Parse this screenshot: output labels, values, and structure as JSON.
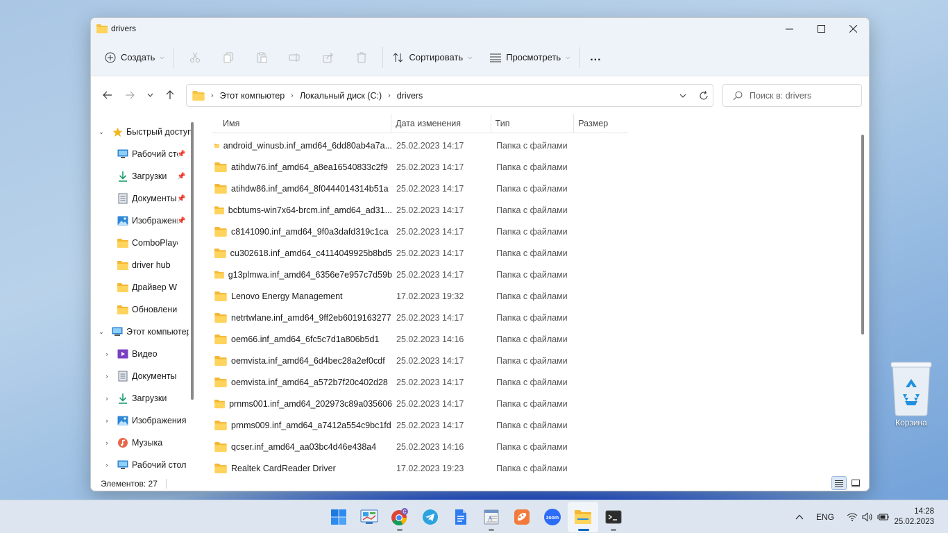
{
  "window": {
    "title": "drivers"
  },
  "toolbar": {
    "create_label": "Создать",
    "sort_label": "Сортировать",
    "view_label": "Просмотреть",
    "more_label": "..."
  },
  "address": {
    "crumbs": [
      "Этот компьютер",
      "Локальный диск (C:)",
      "drivers"
    ],
    "search_placeholder": "Поиск в: drivers"
  },
  "sidebar": {
    "quick_access": "Быстрый доступ",
    "quick_items": [
      {
        "label": "Рабочий стол",
        "icon": "desktop-icon",
        "pinned": true
      },
      {
        "label": "Загрузки",
        "icon": "download-icon",
        "pinned": true
      },
      {
        "label": "Документы",
        "icon": "documents-icon",
        "pinned": true
      },
      {
        "label": "Изображения",
        "icon": "pictures-icon",
        "pinned": true
      },
      {
        "label": "ComboPlayer",
        "icon": "folder-icon",
        "pinned": false
      },
      {
        "label": "driver hub",
        "icon": "folder-icon",
        "pinned": false
      },
      {
        "label": "Драйвер WIA",
        "icon": "folder-icon",
        "pinned": false
      },
      {
        "label": "Обновление драйверов",
        "icon": "folder-icon",
        "pinned": false
      }
    ],
    "this_pc": "Этот компьютер",
    "pc_items": [
      {
        "label": "Видео",
        "icon": "video-icon"
      },
      {
        "label": "Документы",
        "icon": "documents-icon"
      },
      {
        "label": "Загрузки",
        "icon": "download-icon"
      },
      {
        "label": "Изображения",
        "icon": "pictures-icon"
      },
      {
        "label": "Музыка",
        "icon": "music-icon"
      },
      {
        "label": "Рабочий стол",
        "icon": "desktop-icon"
      }
    ]
  },
  "columns": {
    "name": "Имя",
    "date": "Дата изменения",
    "type": "Тип",
    "size": "Размер"
  },
  "files": [
    {
      "name": "android_winusb.inf_amd64_6dd80ab4a7a...",
      "date": "25.02.2023 14:17",
      "type": "Папка с файлами"
    },
    {
      "name": "atihdw76.inf_amd64_a8ea16540833c2f9",
      "date": "25.02.2023 14:17",
      "type": "Папка с файлами"
    },
    {
      "name": "atihdw86.inf_amd64_8f0444014314b51a",
      "date": "25.02.2023 14:17",
      "type": "Папка с файлами"
    },
    {
      "name": "bcbtums-win7x64-brcm.inf_amd64_ad31...",
      "date": "25.02.2023 14:17",
      "type": "Папка с файлами"
    },
    {
      "name": "c8141090.inf_amd64_9f0a3dafd319c1ca",
      "date": "25.02.2023 14:17",
      "type": "Папка с файлами"
    },
    {
      "name": "cu302618.inf_amd64_c4114049925b8bd5",
      "date": "25.02.2023 14:17",
      "type": "Папка с файлами"
    },
    {
      "name": "g13plmwa.inf_amd64_6356e7e957c7d59b",
      "date": "25.02.2023 14:17",
      "type": "Папка с файлами"
    },
    {
      "name": "Lenovo Energy Management",
      "date": "17.02.2023 19:32",
      "type": "Папка с файлами"
    },
    {
      "name": "netrtwlane.inf_amd64_9ff2eb6019163277",
      "date": "25.02.2023 14:17",
      "type": "Папка с файлами"
    },
    {
      "name": "oem66.inf_amd64_6fc5c7d1a806b5d1",
      "date": "25.02.2023 14:16",
      "type": "Папка с файлами"
    },
    {
      "name": "oemvista.inf_amd64_6d4bec28a2ef0cdf",
      "date": "25.02.2023 14:17",
      "type": "Папка с файлами"
    },
    {
      "name": "oemvista.inf_amd64_a572b7f20c402d28",
      "date": "25.02.2023 14:17",
      "type": "Папка с файлами"
    },
    {
      "name": "prnms001.inf_amd64_202973c89a035606",
      "date": "25.02.2023 14:17",
      "type": "Папка с файлами"
    },
    {
      "name": "prnms009.inf_amd64_a7412a554c9bc1fd",
      "date": "25.02.2023 14:17",
      "type": "Папка с файлами"
    },
    {
      "name": "qcser.inf_amd64_aa03bc4d46e438a4",
      "date": "25.02.2023 14:16",
      "type": "Папка с файлами"
    },
    {
      "name": "Realtek CardReader Driver",
      "date": "17.02.2023 19:23",
      "type": "Папка с файлами"
    }
  ],
  "status": {
    "items_count": "Элементов: 27"
  },
  "desktop": {
    "recycle_bin": "Корзина"
  },
  "taskbar": {
    "apps": [
      "start-icon",
      "control-panel-icon",
      "chrome-icon",
      "telegram-icon",
      "docs-icon",
      "wordpad-icon",
      "paint-icon",
      "zoom-icon",
      "explorer-icon",
      "terminal-icon"
    ],
    "chrome_badge": "C",
    "zoom_label": "zoom",
    "lang": "ENG",
    "time": "14:28",
    "date": "25.02.2023"
  },
  "colors": {
    "accent": "#0067c0",
    "folder": "#f5c242"
  }
}
